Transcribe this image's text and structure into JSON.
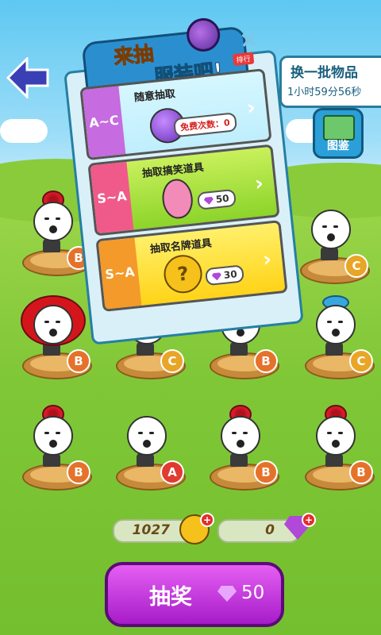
{
  "header": {
    "back_icon": "back-arrow-icon",
    "refresh_label": "换一批物品",
    "refresh_timer": "1小时59分56秒",
    "collection_label": "图鉴"
  },
  "dialog": {
    "title_line1": "来抽",
    "title_line2": "服装吧!",
    "rank_tag": "排行",
    "close_icon": "close-x-icon",
    "options": [
      {
        "tag": "A~C",
        "title": "随意抽取",
        "free_text": "免费次数：0"
      },
      {
        "tag": "S~A",
        "title": "抽取搞笑道具",
        "cost": "50"
      },
      {
        "tag": "S~A",
        "title": "抽取名牌道具",
        "cost": "30"
      }
    ]
  },
  "characters": [
    {
      "grade": "B",
      "hat": "flower"
    },
    {
      "grade": "C",
      "hat": "none"
    },
    {
      "grade": "B",
      "hat": "afro"
    },
    {
      "grade": "C",
      "hat": "none"
    },
    {
      "grade": "B",
      "hat": "flower"
    },
    {
      "grade": "C",
      "hat": "fish"
    },
    {
      "grade": "B",
      "hat": "flower"
    },
    {
      "grade": "A",
      "hat": "none"
    },
    {
      "grade": "B",
      "hat": "flower"
    },
    {
      "grade": "B",
      "hat": "flower"
    }
  ],
  "resources": {
    "gold": "1027",
    "gems": "0"
  },
  "draw_button": {
    "label": "抽奖",
    "cost": "50"
  },
  "colors": {
    "sky": "#5ec8f2",
    "grass": "#7fc737",
    "draw_button": "#c33de0",
    "grade_B": "#e5722a",
    "grade_C": "#e8a526",
    "grade_A": "#e03a31"
  }
}
